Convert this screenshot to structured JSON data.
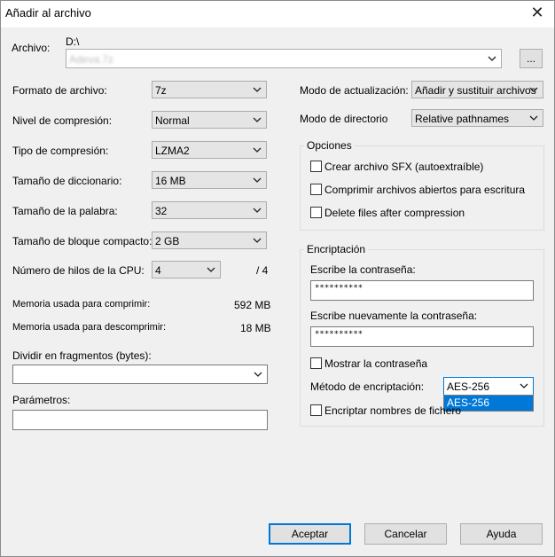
{
  "window": {
    "title": "Añadir al archivo",
    "close": "✕"
  },
  "archive": {
    "label": "Archivo:",
    "path": "D:\\",
    "filename": "Adeva.7z",
    "browse": "..."
  },
  "left": {
    "format": {
      "label": "Formato de archivo:",
      "value": "7z"
    },
    "level": {
      "label": "Nivel de compresión:",
      "value": "Normal"
    },
    "type": {
      "label": "Tipo de compresión:",
      "value": "LZMA2"
    },
    "dict": {
      "label": "Tamaño de diccionario:",
      "value": "16 MB"
    },
    "word": {
      "label": "Tamaño de la palabra:",
      "value": "32"
    },
    "block": {
      "label": "Tamaño de bloque compacto:",
      "value": "2 GB"
    },
    "threads": {
      "label": "Número de hilos de la CPU:",
      "value": "4",
      "max": "/ 4"
    },
    "mem_compress": {
      "label": "Memoria usada para comprimir:",
      "value": "592 MB"
    },
    "mem_decompress": {
      "label": "Memoria usada para descomprimir:",
      "value": "18 MB"
    },
    "split": {
      "label": "Dividir en fragmentos (bytes):",
      "value": ""
    },
    "params": {
      "label": "Parámetros:",
      "value": ""
    }
  },
  "right": {
    "update": {
      "label": "Modo de actualización:",
      "value": "Añadir y sustituir archivos"
    },
    "dirmode": {
      "label": "Modo de directorio",
      "value": "Relative pathnames"
    },
    "options": {
      "title": "Opciones",
      "sfx": "Crear archivo SFX (autoextraíble)",
      "open": "Comprimir archivos abiertos para escritura",
      "delete": "Delete files after compression"
    },
    "encryption": {
      "title": "Encriptación",
      "pass_label": "Escribe la contraseña:",
      "pass_value": "**********",
      "repass_label": "Escribe nuevamente la contraseña:",
      "repass_value": "**********",
      "show": "Mostrar la contraseña",
      "method_label": "Método de encriptación:",
      "method_value": "AES-256",
      "method_option": "AES-256",
      "names": "Encriptar nombres de fichero"
    }
  },
  "buttons": {
    "ok": "Aceptar",
    "cancel": "Cancelar",
    "help": "Ayuda"
  }
}
